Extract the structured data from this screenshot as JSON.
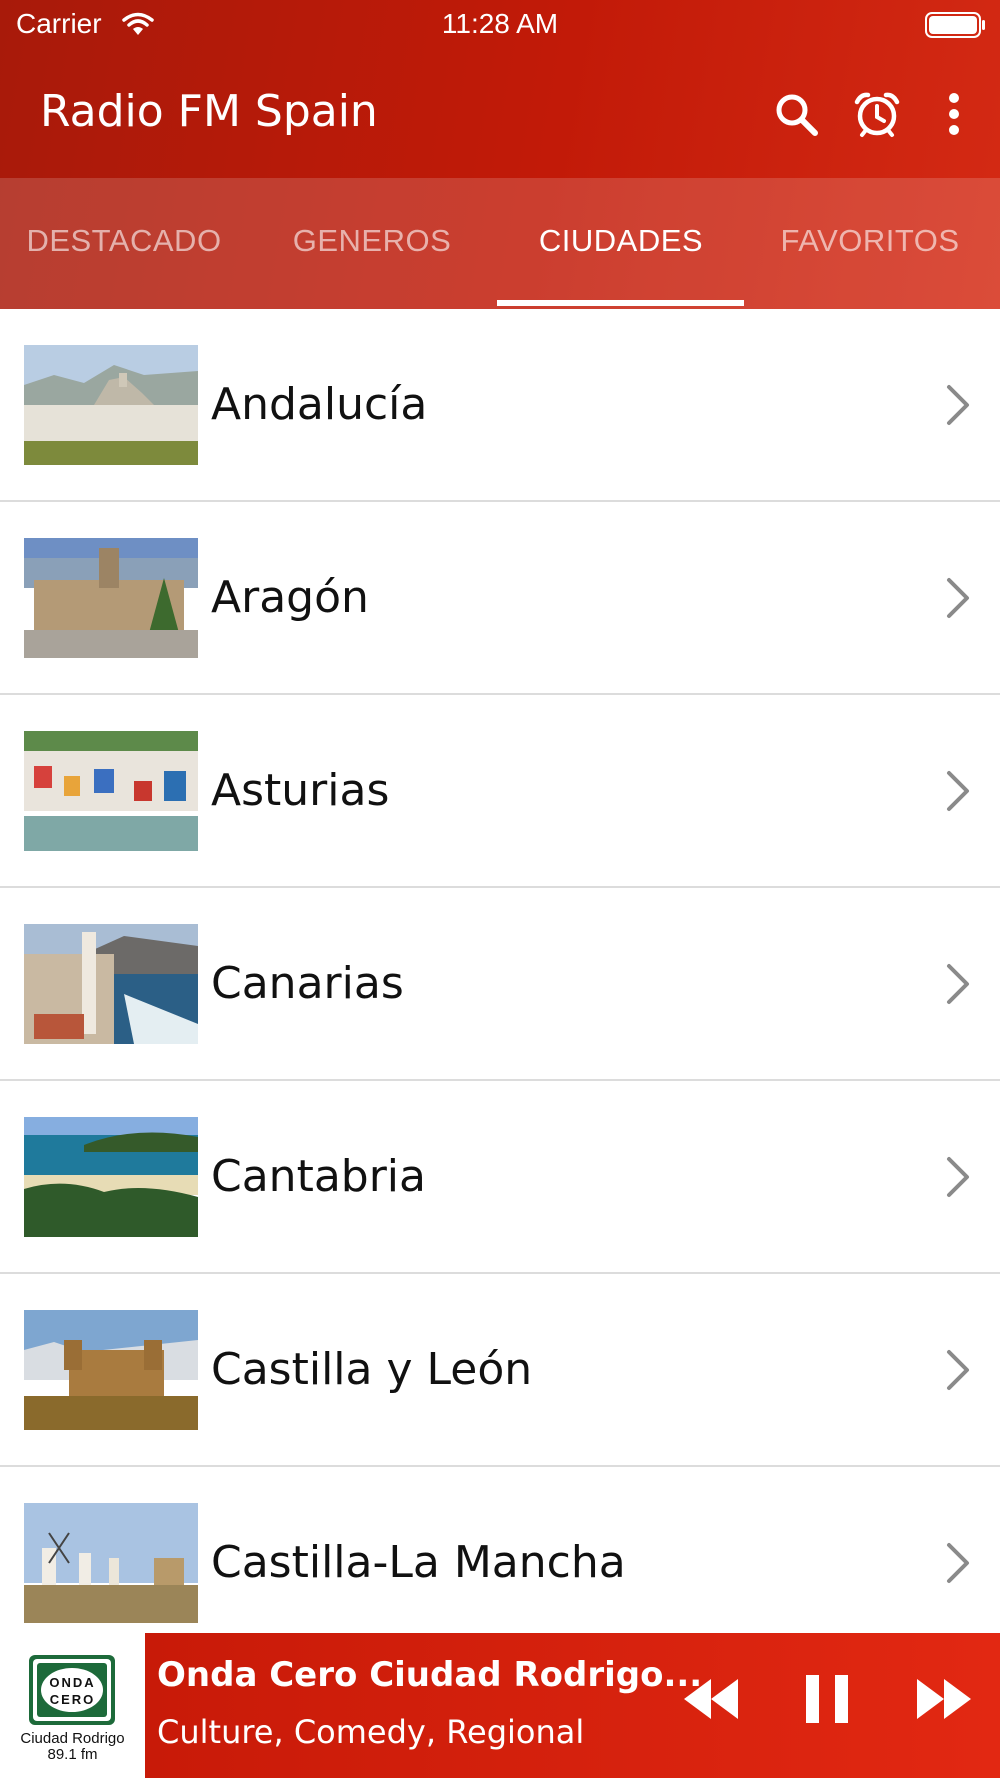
{
  "status": {
    "carrier": "Carrier",
    "time": "11:28 AM"
  },
  "app": {
    "title": "Radio FM Spain"
  },
  "tabs": [
    {
      "label": "DESTACADO",
      "active": false
    },
    {
      "label": "GENEROS",
      "active": false
    },
    {
      "label": "CIUDADES",
      "active": true
    },
    {
      "label": "FAVORITOS",
      "active": false
    }
  ],
  "regions": [
    {
      "label": "Andalucía"
    },
    {
      "label": "Aragón"
    },
    {
      "label": "Asturias"
    },
    {
      "label": "Canarias"
    },
    {
      "label": "Cantabria"
    },
    {
      "label": "Castilla y León"
    },
    {
      "label": "Castilla-La Mancha"
    }
  ],
  "player": {
    "title": "Onda Cero Ciudad Rodrigo...",
    "subtitle": "Culture, Comedy, Regional",
    "logo_line1": "ONDA",
    "logo_line2": "CERO",
    "logo_caption": "Ciudad Rodrigo",
    "logo_freq": "89.1 fm"
  },
  "colors": {
    "brand": "#c21a08",
    "accent": "#e22812"
  },
  "icons": [
    "wifi-icon",
    "battery-icon",
    "search-icon",
    "alarm-icon",
    "more-vertical-icon",
    "chevron-right-icon",
    "rewind-icon",
    "pause-icon",
    "fast-forward-icon"
  ]
}
